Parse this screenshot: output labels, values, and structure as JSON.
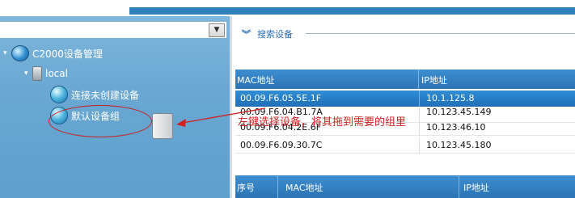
{
  "tree": {
    "root_label": "C2000设备管理",
    "local_label": "local",
    "items": [
      {
        "label": "连接未创建设备"
      },
      {
        "label": "默认设备组"
      }
    ]
  },
  "search": {
    "title": "搜索设备"
  },
  "devices_table": {
    "headers": {
      "mac": "MAC地址",
      "ip": "IP地址"
    },
    "rows": [
      {
        "mac": "00.09.F6.05.5E.1F",
        "ip": "10.1.125.8"
      },
      {
        "mac": "00.09.F6.04.B1.7A",
        "ip": "10.123.45.149"
      },
      {
        "mac": "00.09.F6.04.2E.6F",
        "ip": "10.123.46.10"
      },
      {
        "mac": "00.09.F6.09.30.7C",
        "ip": "10.123.45.180"
      }
    ]
  },
  "group_table": {
    "headers": {
      "seq": "序号",
      "mac": "MAC地址",
      "ip": "IP地址"
    }
  },
  "annotation": {
    "text": "左键选择设备，将其拖到需要的组里",
    "color": "#d22020"
  },
  "colors": {
    "accent": "#2b74b5",
    "tree_bg": "#6aa8d3",
    "selected_row": "#1f6fb8"
  }
}
